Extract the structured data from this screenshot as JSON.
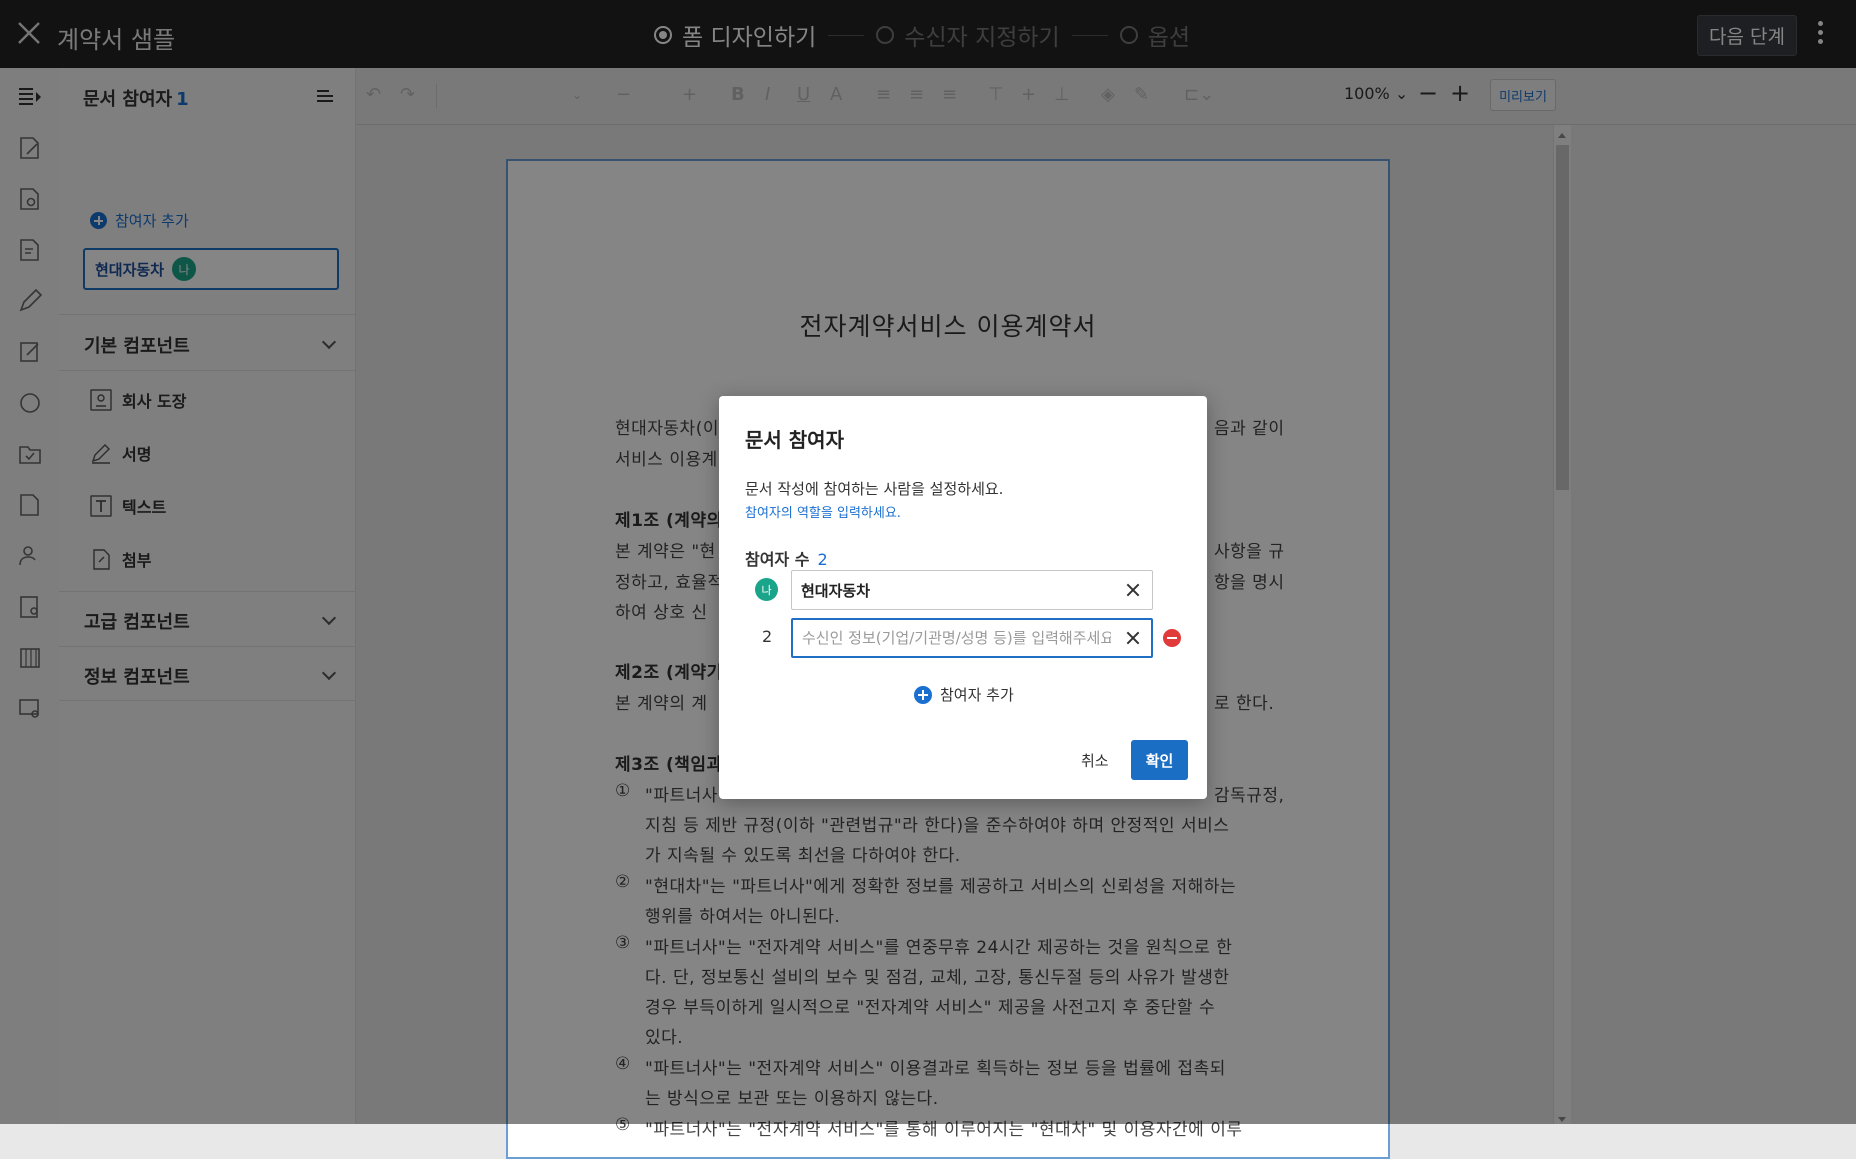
{
  "header": {
    "document_title": "계약서 샘플",
    "steps": [
      {
        "label": "폼 디자인하기",
        "active": true
      },
      {
        "label": "수신자 지정하기",
        "active": false
      },
      {
        "label": "옵션",
        "active": false
      }
    ],
    "next_button": "다음 단계"
  },
  "panel": {
    "title": "문서 참여자",
    "participant_count": "1",
    "add_participant": "참여자 추가",
    "participants": [
      {
        "name": "현대자동차",
        "badge": "나"
      }
    ],
    "sections": {
      "basic": "기본 컴포넌트",
      "advanced": "고급 컴포넌트",
      "info": "정보 컴포넌트"
    },
    "components": [
      "회사 도장",
      "서명",
      "텍스트",
      "첨부"
    ]
  },
  "toolbar": {
    "zoom": "100%",
    "preview": "미리보기"
  },
  "document": {
    "title": "전자계약서비스 이용계약서",
    "lines": [
      {
        "text": "현대자동차(이",
        "b": false
      },
      {
        "text": "음과 같이",
        "b": false
      },
      {
        "text": "서비스 이용계",
        "b": false
      },
      {
        "text": "제1조 (계약의",
        "b": true
      },
      {
        "text": "본 계약은 \"현",
        "b": false
      },
      {
        "text": "사항을 규",
        "b": false
      },
      {
        "text": "정하고, 효율적",
        "b": false
      },
      {
        "text": "항을 명시",
        "b": false
      },
      {
        "text": "하여 상호 신",
        "b": false
      },
      {
        "text": "제2조 (계약기",
        "b": true
      },
      {
        "text": "본 계약의 계",
        "b": false
      },
      {
        "text": "로 한다.",
        "b": false
      },
      {
        "text": "제3조 (책임과",
        "b": true
      },
      {
        "text": "\"파트너사",
        "b": false
      },
      {
        "text": "감독규정,",
        "b": false
      },
      {
        "text": "지침 등 제반 규정(이하 \"관련법규\"라 한다)을 준수하여야 하며 안정적인 서비스",
        "b": false
      },
      {
        "text": "가 지속될 수 있도록 최선을 다하여야 한다.",
        "b": false
      },
      {
        "text": "\"현대차\"는 \"파트너사\"에게 정확한 정보를 제공하고 서비스의 신뢰성을 저해하는",
        "b": false
      },
      {
        "text": "행위를 하여서는 아니된다.",
        "b": false
      },
      {
        "text": "\"파트너사\"는 \"전자계약 서비스\"를 연중무휴 24시간 제공하는 것을 원칙으로 한",
        "b": false
      },
      {
        "text": "다. 단, 정보통신 설비의 보수 및 점검, 교체, 고장, 통신두절 등의 사유가 발생한",
        "b": false
      },
      {
        "text": "경우 부득이하게 일시적으로 \"전자계약 서비스\" 제공을 사전고지 후 중단할 수",
        "b": false
      },
      {
        "text": "있다.",
        "b": false
      },
      {
        "text": "\"파트너사\"는 \"전자계약 서비스\" 이용결과로 획득하는 정보 등을 법률에 접촉되",
        "b": false
      },
      {
        "text": "는 방식으로 보관 또는 이용하지 않는다.",
        "b": false
      },
      {
        "text": "\"파트너사\"는 \"전자계약 서비스\"를 통해 이루어지는 \"현대차\" 및 이용자간에 이루",
        "b": false
      }
    ],
    "markers": [
      "①",
      "②",
      "③",
      "④",
      "⑤"
    ]
  },
  "modal": {
    "title": "문서 참여자",
    "description": "문서 작성에 참여하는 사람을 설정하세요.",
    "hint": "참여자의 역할을 입력하세요.",
    "count_label": "참여자 수",
    "count_value": "2",
    "rows": [
      {
        "badge": "나",
        "value": "현대자동차",
        "placeholder": ""
      },
      {
        "number": "2",
        "value": "",
        "placeholder": "수신인 정보(기업/기관명/성명 등)를 입력해주세요."
      }
    ],
    "add_participant": "참여자 추가",
    "cancel": "취소",
    "confirm": "확인"
  }
}
